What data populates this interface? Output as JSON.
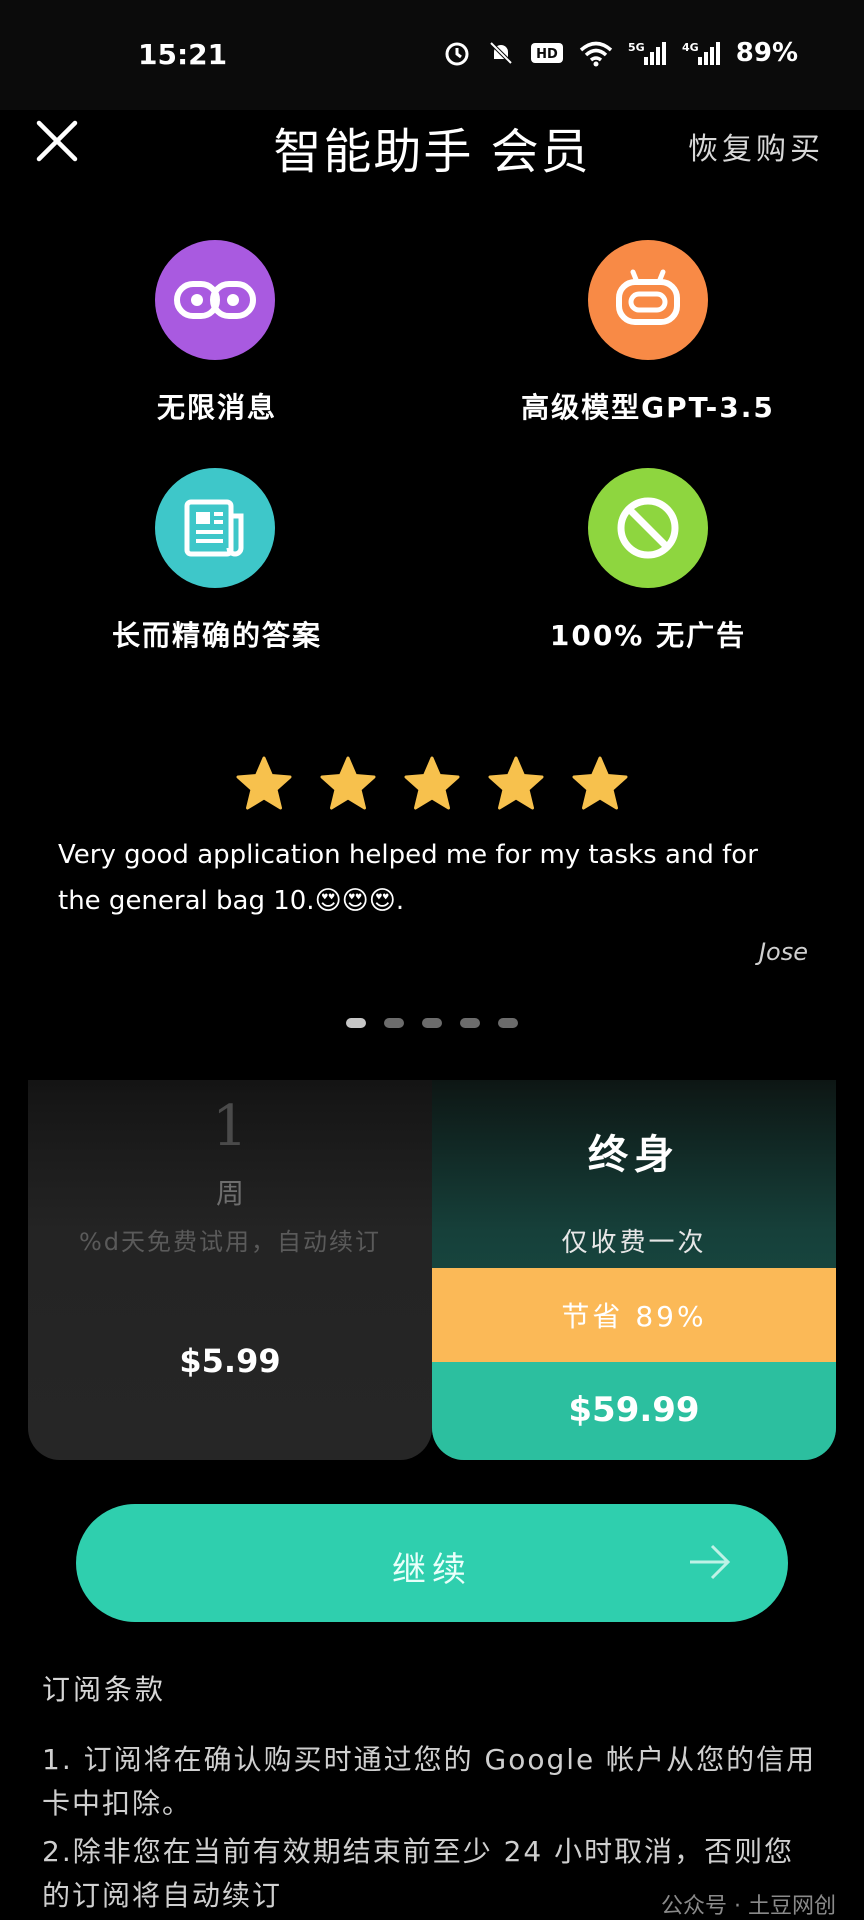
{
  "status_bar": {
    "time": "15:21",
    "icons": [
      "alarm-icon",
      "bell-off-icon",
      "hd-icon",
      "wifi-icon",
      "signal-5g-icon",
      "signal-4g-icon"
    ],
    "battery": "89%"
  },
  "header": {
    "title": "智能助手 会员",
    "restore": "恢复购买"
  },
  "features": [
    {
      "label": "无限消息",
      "icon": "infinity-icon",
      "color": "#a95ae0"
    },
    {
      "label": "高级模型GPT-3.5",
      "icon": "robot-icon",
      "color": "#f88a46"
    },
    {
      "label": "长而精确的答案",
      "icon": "document-icon",
      "color": "#3ec7c9"
    },
    {
      "label": "100% 无广告",
      "icon": "no-ads-icon",
      "color": "#8ed63f"
    }
  ],
  "review": {
    "stars": 5,
    "text": "Very good application helped me for my tasks and for the general bag 10.😍😍😍.",
    "author": "Jose",
    "carousel_pages": 5,
    "active_page": 1
  },
  "plans": {
    "weekly": {
      "number": "1",
      "unit": "周",
      "description": "%d天免费试用，自动续订",
      "price": "$5.99"
    },
    "lifetime": {
      "title": "终身",
      "description": "仅收费一次",
      "savings": "节省 89%",
      "price": "$59.99"
    }
  },
  "continue_button": {
    "label": "继续"
  },
  "terms": {
    "title": "订阅条款",
    "items": [
      "1. 订阅将在确认购买时通过您的 Google 帐户从您的信用卡中扣除。",
      "2.除非您在当前有效期结束前至少 24 小时取消，否则您的订阅将自动续订"
    ]
  },
  "watermark": "公众号 · 土豆网创",
  "colors": {
    "accent": "#2fcfae",
    "savings": "#fbb957",
    "background": "#000000"
  }
}
